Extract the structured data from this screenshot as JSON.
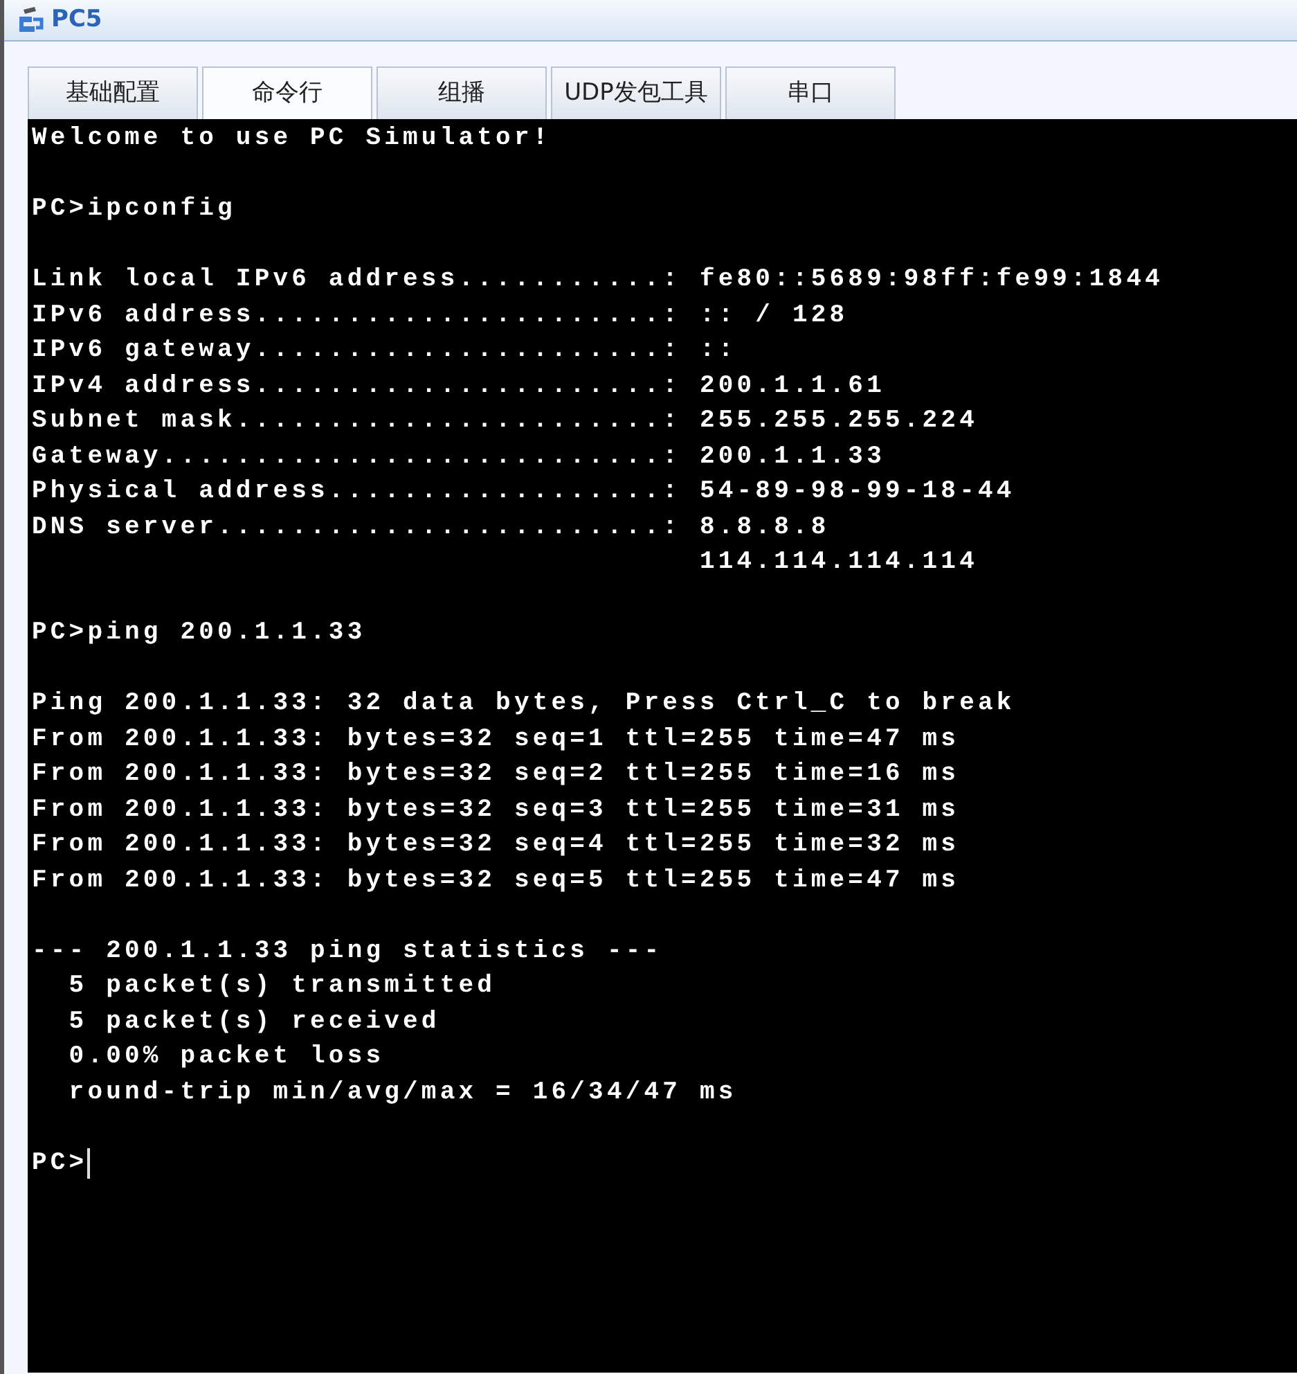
{
  "window": {
    "title": "PC5"
  },
  "tabs": [
    {
      "label": "基础配置",
      "selected": false
    },
    {
      "label": "命令行",
      "selected": true
    },
    {
      "label": "组播",
      "selected": false
    },
    {
      "label": "UDP发包工具",
      "selected": false
    },
    {
      "label": "串口",
      "selected": false
    }
  ],
  "terminal": {
    "blocks": [
      [
        "Welcome to use PC Simulator!"
      ],
      [
        "PC>ipconfig"
      ],
      [
        "Link local IPv6 address...........: fe80::5689:98ff:fe99:1844",
        "IPv6 address......................: :: / 128",
        "IPv6 gateway......................: ::",
        "IPv4 address......................: 200.1.1.61",
        "Subnet mask.......................: 255.255.255.224",
        "Gateway...........................: 200.1.1.33",
        "Physical address..................: 54-89-98-99-18-44",
        "DNS server........................: 8.8.8.8",
        "                                    114.114.114.114"
      ],
      [
        "PC>ping 200.1.1.33"
      ],
      [
        "Ping 200.1.1.33: 32 data bytes, Press Ctrl_C to break",
        "From 200.1.1.33: bytes=32 seq=1 ttl=255 time=47 ms",
        "From 200.1.1.33: bytes=32 seq=2 ttl=255 time=16 ms",
        "From 200.1.1.33: bytes=32 seq=3 ttl=255 time=31 ms",
        "From 200.1.1.33: bytes=32 seq=4 ttl=255 time=32 ms",
        "From 200.1.1.33: bytes=32 seq=5 ttl=255 time=47 ms"
      ],
      [
        "--- 200.1.1.33 ping statistics ---",
        "  5 packet(s) transmitted",
        "  5 packet(s) received",
        "  0.00% packet loss",
        "  round-trip min/avg/max = 16/34/47 ms"
      ]
    ],
    "prompt": "PC>"
  }
}
